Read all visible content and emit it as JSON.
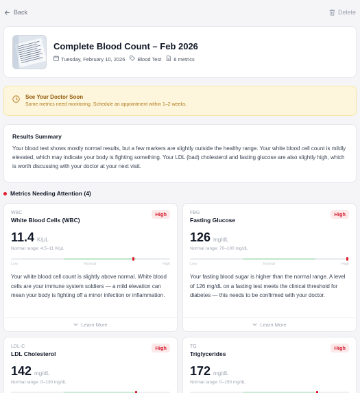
{
  "nav": {
    "back_label": "Back",
    "delete_label": "Delete"
  },
  "report": {
    "title": "Complete Blood Count – Feb 2026",
    "date": "Tuesday, February 10, 2026",
    "type": "Blood Test",
    "metrics_count": "8 metrics"
  },
  "alert": {
    "title": "See Your Doctor Soon",
    "body": "Some metrics need monitoring. Schedule an appointment within 1–2 weeks.",
    "color": "#92580a"
  },
  "summary": {
    "heading": "Results Summary",
    "text": "Your blood test shows mostly normal results, but a few markers are slightly outside the healthy range. Your white blood cell count is mildly elevated, which may indicate your body is fighting something. Your LDL (bad) cholesterol and fasting glucose are also slightly high, which is worth discussing with your doctor at your next visit."
  },
  "attention": {
    "heading": "Metrics Needing Attention (4)"
  },
  "bar_labels": {
    "low": "Low",
    "normal": "Normal",
    "high": "High"
  },
  "learn_more_label": "Learn More",
  "metrics": [
    {
      "abbr": "WBC",
      "name": "White Blood Cells (WBC)",
      "badge": "High",
      "value": "11.4",
      "unit": "K/µL",
      "range": "Normal range: 4.5–11 K/µL",
      "marker_fraction": 0.77,
      "desc": "Your white blood cell count is slightly above normal. White blood cells are your immune system soldiers — a mild elevation can mean your body is fighting off a minor infection or inflammation."
    },
    {
      "abbr": "FBG",
      "name": "Fasting Glucose",
      "badge": "High",
      "value": "126",
      "unit": "mg/dL",
      "range": "Normal range: 70–100 mg/dL",
      "marker_fraction": 0.99,
      "desc": "Your fasting blood sugar is higher than the normal range. A level of 126 mg/dL on a fasting test meets the clinical threshold for diabetes — this needs to be confirmed with your doctor."
    },
    {
      "abbr": "LDL-C",
      "name": "LDL Cholesterol",
      "badge": "High",
      "value": "142",
      "unit": "mg/dL",
      "range": "Normal range: 0–130 mg/dL",
      "marker_fraction": 0.79,
      "desc": ""
    },
    {
      "abbr": "TG",
      "name": "Triglycerides",
      "badge": "High",
      "value": "172",
      "unit": "mg/dL",
      "range": "Normal range: 0–150 mg/dL",
      "marker_fraction": 0.8,
      "desc": ""
    }
  ]
}
